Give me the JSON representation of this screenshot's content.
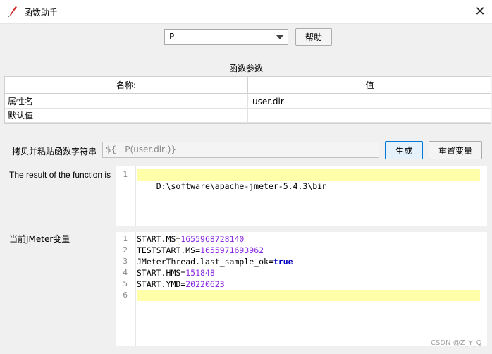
{
  "window": {
    "title": "函数助手",
    "icon": "feather-pen-icon",
    "close_glyph": "✕"
  },
  "function_select": {
    "value": "P"
  },
  "help_button": "帮助",
  "params_label": "函数参数",
  "table": {
    "headers": [
      "名称:",
      "值"
    ],
    "rows": [
      {
        "name": "属性名",
        "value": "user.dir"
      },
      {
        "name": "默认值",
        "value": ""
      }
    ]
  },
  "copy_label": "拷贝并粘贴函数字符串",
  "function_string": "${__P(user.dir,)}",
  "generate_button": "生成",
  "reset_button": "重置变量",
  "result_label": "The result of the function is",
  "result_lines": [
    {
      "num": "1",
      "text": "D:\\software\\apache-jmeter-5.4.3\\bin"
    }
  ],
  "vars_label": "当前JMeter变量",
  "vars_lines": [
    {
      "num": "1",
      "key": "START.MS",
      "value": "1655968728140"
    },
    {
      "num": "2",
      "key": "TESTSTART.MS",
      "value": "1655971693962"
    },
    {
      "num": "3",
      "key": "JMeterThread.last_sample_ok",
      "value": "true"
    },
    {
      "num": "4",
      "key": "START.HMS",
      "value": "151848"
    },
    {
      "num": "5",
      "key": "START.YMD",
      "value": "20220623"
    },
    {
      "num": "6",
      "key": "",
      "value": ""
    }
  ],
  "watermark": "CSDN @Z_Y_Q",
  "colors": {
    "accent": "#0078d7",
    "highlight": "#ffffaa",
    "number": "#8a2be2",
    "keyword": "#0000c0"
  }
}
